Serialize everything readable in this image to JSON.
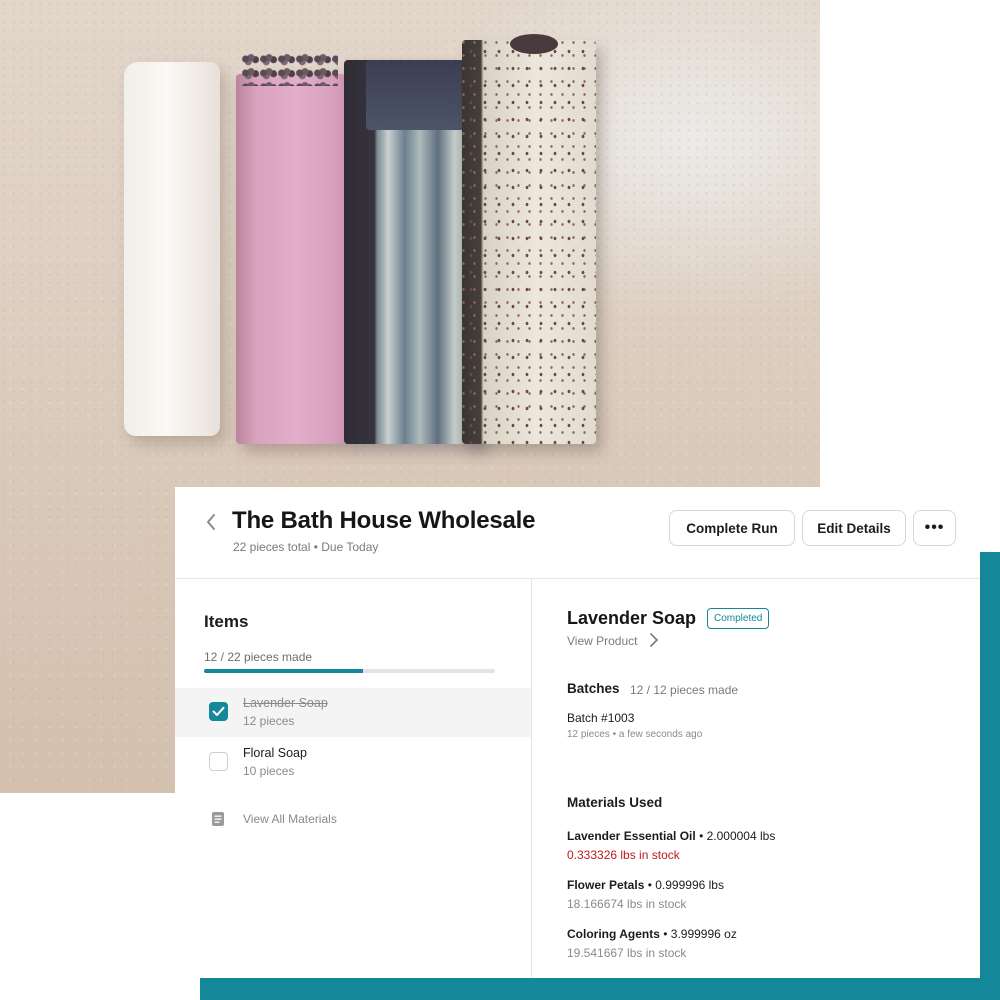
{
  "header": {
    "title": "The Bath House Wholesale",
    "subtitle": "22 pieces total • Due Today",
    "buttons": {
      "complete": "Complete Run",
      "edit": "Edit Details",
      "more": "•••"
    }
  },
  "items_panel": {
    "title": "Items",
    "progress_label": "12 / 22 pieces made",
    "progress_fraction": 0.545,
    "items": [
      {
        "name": "Lavender Soap",
        "qty": "12 pieces",
        "checked": true
      },
      {
        "name": "Floral Soap",
        "qty": "10 pieces",
        "checked": false
      }
    ],
    "view_all_materials": "View All Materials"
  },
  "detail": {
    "product_name": "Lavender Soap",
    "status_badge": "Completed",
    "view_product": "View Product",
    "batches_title": "Batches",
    "batches_count": "12 / 12 pieces made",
    "batch": {
      "name": "Batch #1003",
      "meta": "12 pieces • a few seconds ago"
    },
    "materials_title": "Materials Used",
    "materials": [
      {
        "name": "Lavender Essential Oil",
        "amount": "• 2.000004 lbs",
        "stock": "0.333326 lbs in stock",
        "low": true
      },
      {
        "name": "Flower Petals",
        "amount": "• 0.999996 lbs",
        "stock": "18.166674 lbs in stock",
        "low": false
      },
      {
        "name": "Coloring Agents",
        "amount": "• 3.999996 oz",
        "stock": "19.541667 lbs in stock",
        "low": false
      }
    ]
  },
  "colors": {
    "accent": "#148899",
    "danger": "#c01a1a"
  }
}
